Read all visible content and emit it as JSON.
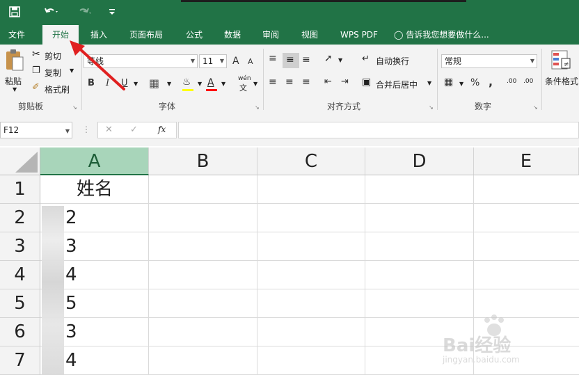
{
  "menu": {
    "tabs": [
      "文件",
      "开始",
      "插入",
      "页面布局",
      "公式",
      "数据",
      "审阅",
      "视图",
      "WPS PDF"
    ],
    "tell_me": "告诉我您想要做什么..."
  },
  "ribbon": {
    "clipboard": {
      "paste": "粘贴",
      "cut": "剪切",
      "copy": "复制",
      "format_painter": "格式刷",
      "label": "剪贴板"
    },
    "font": {
      "name": "等线",
      "size": "11",
      "bold": "B",
      "italic": "I",
      "underline": "U",
      "grow": "A",
      "shrink": "A",
      "label": "字体",
      "wen": "wén"
    },
    "alignment": {
      "wrap": "自动换行",
      "merge": "合并后居中",
      "label": "对齐方式"
    },
    "number": {
      "format": "常规",
      "percent": "%",
      "comma": ",",
      "inc_decimal": ".00",
      "dec_decimal": ".00",
      "label": "数字"
    },
    "styles": {
      "conditional": "条件格式"
    }
  },
  "formula_bar": {
    "name_box": "F12",
    "fx": "fx",
    "cancel": "✕",
    "enter": "✓",
    "value": ""
  },
  "sheet": {
    "columns": [
      "A",
      "B",
      "C",
      "D",
      "E"
    ],
    "rows": [
      "1",
      "2",
      "3",
      "4",
      "5",
      "6",
      "7"
    ],
    "col_a": [
      "姓名",
      "2",
      "3",
      "4",
      "5",
      "3",
      "4"
    ]
  },
  "watermark": {
    "brand": "Bai经验",
    "url": "jingyan.baidu.com"
  },
  "colors": {
    "ribbon_green": "#217346",
    "header_selected": "#a8d5ba",
    "arrow": "#e02020"
  }
}
